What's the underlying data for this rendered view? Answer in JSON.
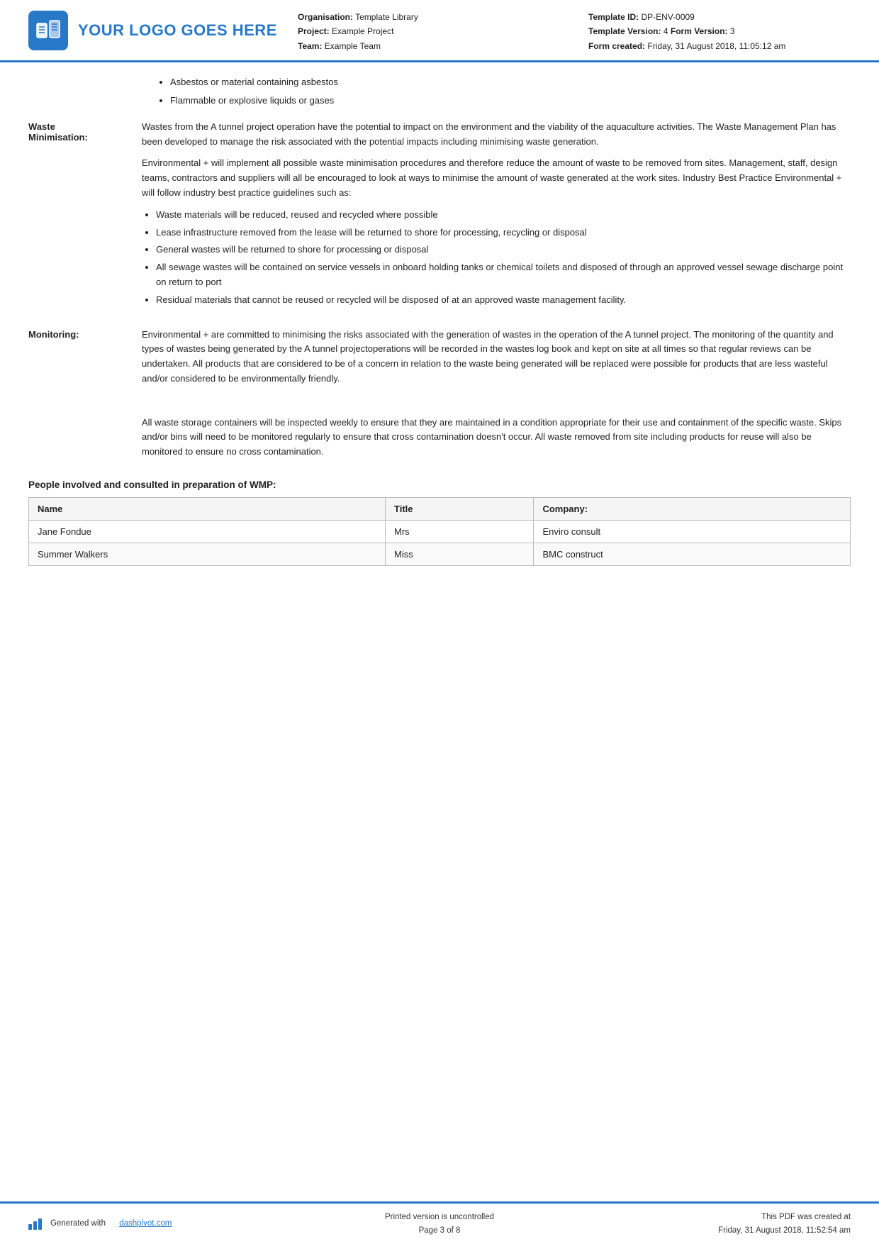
{
  "header": {
    "logo_text": "YOUR LOGO GOES HERE",
    "org_label": "Organisation:",
    "org_value": "Template Library",
    "project_label": "Project:",
    "project_value": "Example Project",
    "team_label": "Team:",
    "team_value": "Example Team",
    "template_id_label": "Template ID:",
    "template_id_value": "DP-ENV-0009",
    "template_version_label": "Template Version:",
    "template_version_value": "4",
    "form_version_label": "Form Version:",
    "form_version_value": "3",
    "form_created_label": "Form created:",
    "form_created_value": "Friday, 31 August 2018, 11:05:12 am"
  },
  "intro_bullets": [
    "Asbestos or material containing asbestos",
    "Flammable or explosive liquids or gases"
  ],
  "sections": [
    {
      "label": "Waste\nMinimisation:",
      "paragraphs": [
        "Wastes from the A tunnel project operation have the potential to impact on the environment and the viability of the aquaculture activities. The Waste Management Plan has been developed to manage the risk associated with the potential impacts including minimising waste generation.",
        "Environmental + will implement all possible waste minimisation procedures and therefore reduce the amount of waste to be removed from sites. Management, staff, design teams, contractors and suppliers will all be encouraged to look at ways to minimise the amount of waste generated at the work sites. Industry Best Practice Environmental + will follow industry best practice guidelines such as:"
      ],
      "bullets": [
        "Waste materials will be reduced, reused and recycled where possible",
        "Lease infrastructure removed from the lease will be returned to shore for processing, recycling or disposal",
        "General wastes will be returned to shore for processing or disposal",
        "All sewage wastes will be contained on service vessels in onboard holding tanks or chemical toilets and disposed of through an approved vessel sewage discharge point on return to port",
        "Residual materials that cannot be reused or recycled will be disposed of at an approved waste management facility."
      ]
    },
    {
      "label": "Monitoring:",
      "paragraphs": [
        "Environmental + are committed to minimising the risks associated with the generation of wastes in the operation of the A tunnel project. The monitoring of the quantity and types of wastes being generated by the A tunnel projectoperations will be recorded in the wastes log book and kept on site at all times so that regular reviews can be undertaken. All products that are considered to be of a concern in relation to the waste being generated will be replaced were possible for products that are less wasteful and/or considered to be environmentally friendly.",
        "",
        "All waste storage containers will be inspected weekly to ensure that they are maintained in a condition appropriate for their use and containment of the specific waste. Skips and/or bins will need to be monitored regularly to ensure that cross contamination doesn't occur. All waste removed from site including products for reuse will also be monitored to ensure no cross contamination."
      ],
      "bullets": []
    }
  ],
  "people_heading": "People involved and consulted in preparation of WMP:",
  "people_table": {
    "columns": [
      "Name",
      "Title",
      "Company:"
    ],
    "rows": [
      [
        "Jane Fondue",
        "Mrs",
        "Enviro consult"
      ],
      [
        "Summer Walkers",
        "Miss",
        "BMC construct"
      ]
    ]
  },
  "footer": {
    "generated_text": "Generated with",
    "generated_link": "dashpivot.com",
    "center_line1": "Printed version is uncontrolled",
    "center_line2": "Page 3 of 8",
    "right_line1": "This PDF was created at",
    "right_line2": "Friday, 31 August 2018, 11:52:54 am"
  }
}
